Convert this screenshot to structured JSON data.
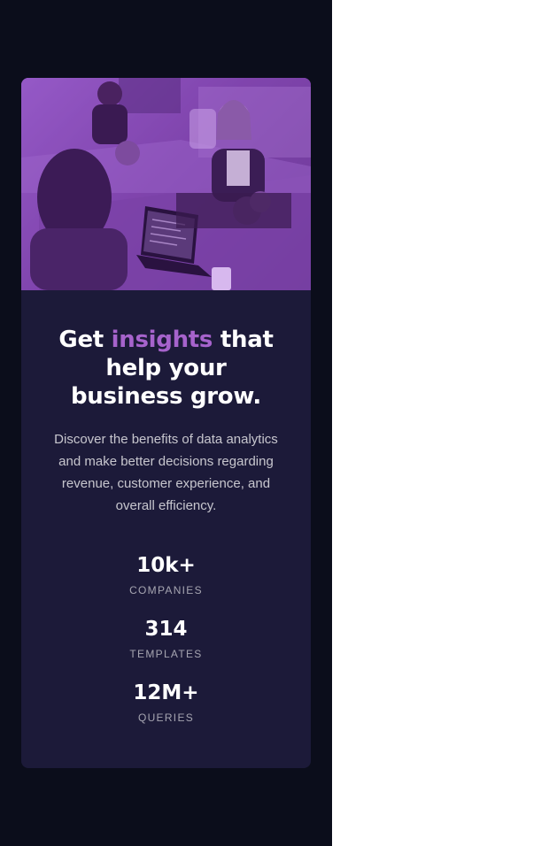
{
  "card": {
    "title_before": "Get ",
    "title_accent": "insights",
    "title_after": " that help your business grow.",
    "description": "Discover the benefits of data analytics and make better decisions regarding revenue, customer experience, and overall efficiency.",
    "stats": [
      {
        "value": "10k+",
        "label": "COMPANIES"
      },
      {
        "value": "314",
        "label": "TEMPLATES"
      },
      {
        "value": "12M+",
        "label": "QUERIES"
      }
    ]
  },
  "colors": {
    "page_background": "#0b0d1b",
    "card_background": "#1c1a39",
    "accent": "#a663cc",
    "outside_background": "#ffffff"
  },
  "hero_image": {
    "icon": "office-team-photo-icon"
  }
}
